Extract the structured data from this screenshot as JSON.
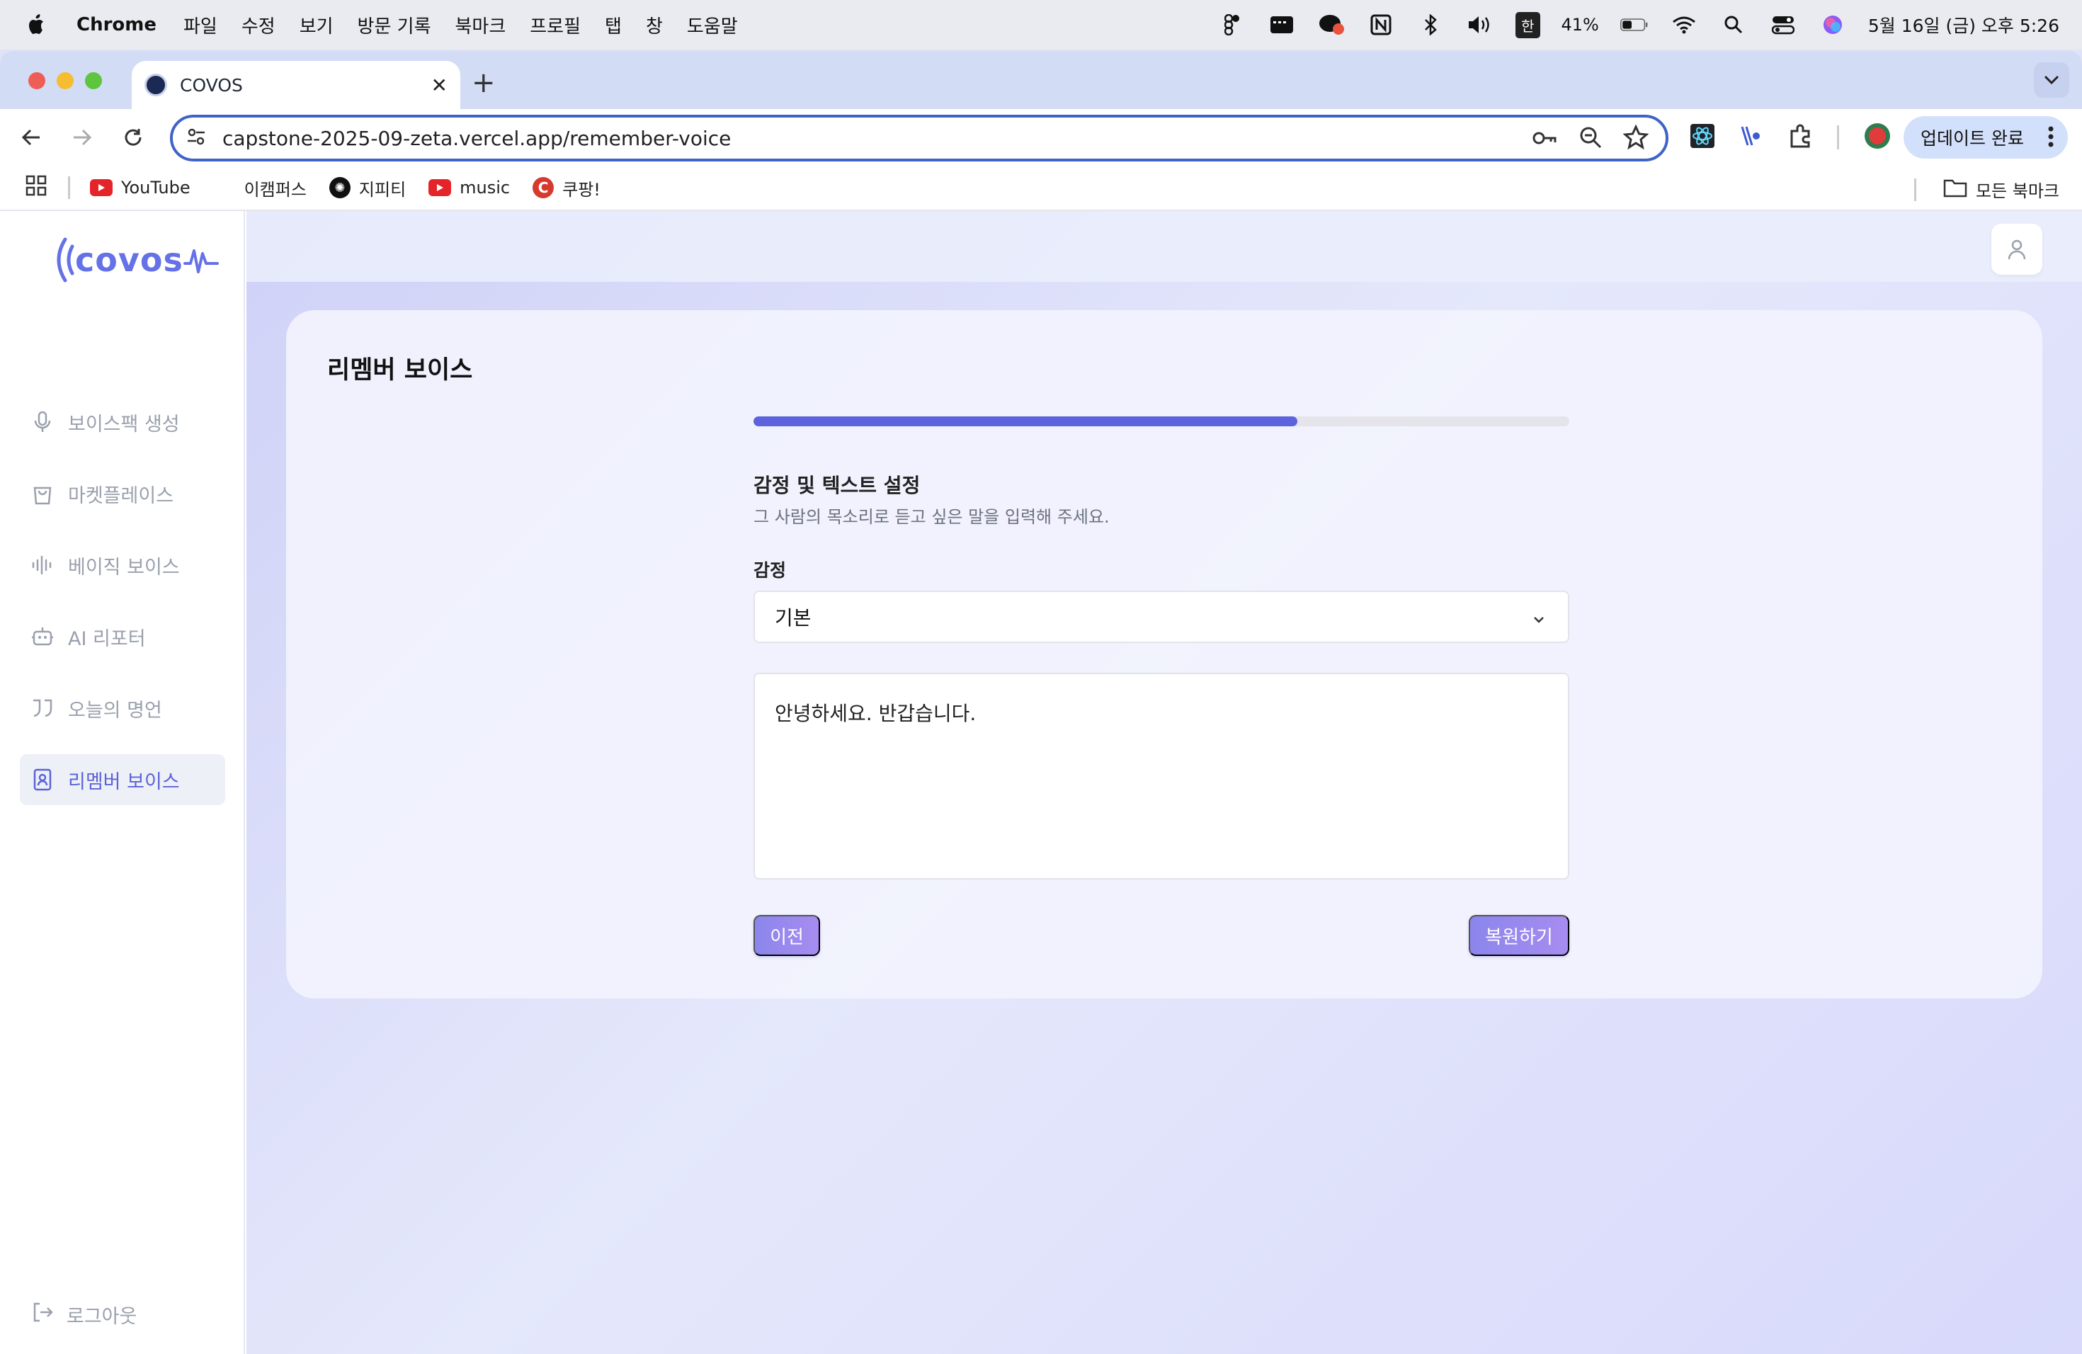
{
  "menubar": {
    "app": "Chrome",
    "items": [
      "파일",
      "수정",
      "보기",
      "방문 기록",
      "북마크",
      "프로필",
      "탭",
      "창",
      "도움말"
    ],
    "ime": "한",
    "battery": "41%",
    "datetime": "5월 16일 (금) 오후 5:26"
  },
  "browser": {
    "tab_title": "COVOS",
    "url": "capstone-2025-09-zeta.vercel.app/remember-voice",
    "update_label": "업데이트 완료",
    "bookmarks": [
      "YouTube",
      "이캠퍼스",
      "지피티",
      "music",
      "쿠팡!"
    ],
    "all_bookmarks": "모든 북마크"
  },
  "sidebar": {
    "logo": "covos",
    "items": [
      {
        "label": "보이스팩 생성",
        "icon": "mic-icon"
      },
      {
        "label": "마켓플레이스",
        "icon": "shopping-bag-icon"
      },
      {
        "label": "베이직 보이스",
        "icon": "audio-wave-icon"
      },
      {
        "label": "AI 리포터",
        "icon": "bot-icon"
      },
      {
        "label": "오늘의 명언",
        "icon": "quote-icon"
      },
      {
        "label": "리멤버 보이스",
        "icon": "contact-book-icon"
      }
    ],
    "logout": "로그아웃"
  },
  "card": {
    "title": "리멤버 보이스",
    "progress": 0.667,
    "section_title": "감정 및 텍스트 설정",
    "section_desc": "그 사람의 목소리로 듣고 싶은 말을 입력해 주세요.",
    "emotion_label": "감정",
    "emotion_value": "기본",
    "text_value": "안녕하세요. 반갑습니다.",
    "prev_label": "이전",
    "restore_label": "복원하기"
  },
  "colors": {
    "accent": "#5c63dc",
    "button": "#9a89ee",
    "active_nav_bg": "#eef0f8"
  }
}
